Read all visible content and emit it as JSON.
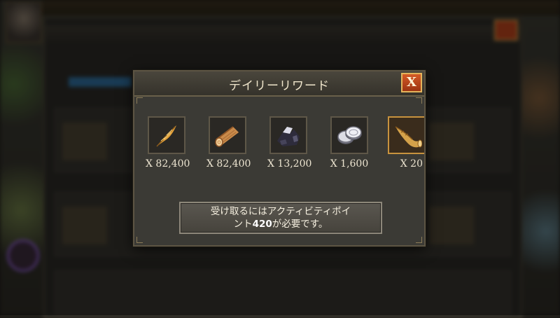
{
  "dialog": {
    "title": "デイリーリワード",
    "close_label": "X"
  },
  "rewards": [
    {
      "icon": "feather-icon",
      "amount": "X 82,400"
    },
    {
      "icon": "wood-log-icon",
      "amount": "X 82,400"
    },
    {
      "icon": "iron-ore-icon",
      "amount": "X 13,200"
    },
    {
      "icon": "silver-coins-icon",
      "amount": "X 1,600"
    },
    {
      "icon": "horn-icon",
      "amount": "X 20"
    }
  ],
  "notice": {
    "line1": "受け取るにはアクティビティポイ",
    "line2_prefix": "ント",
    "points": "420",
    "line2_suffix": "が必要です。"
  },
  "colors": {
    "close_button": "#c44a1c",
    "highlight_border": "#c8933e",
    "panel_bg": "#3b3a35"
  }
}
